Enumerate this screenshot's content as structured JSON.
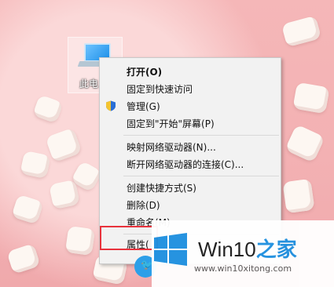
{
  "desktop": {
    "icon_label": "此电"
  },
  "context_menu": {
    "items": [
      {
        "label": "打开(O)",
        "bold": true
      },
      {
        "label": "固定到快速访问"
      },
      {
        "label": "管理(G)",
        "icon": "shield-icon"
      },
      {
        "label": "固定到\"开始\"屏幕(P)"
      },
      {
        "label": "映射网络驱动器(N)..."
      },
      {
        "label": "断开网络驱动器的连接(C)..."
      },
      {
        "label": "创建快捷方式(S)"
      },
      {
        "label": "删除(D)"
      },
      {
        "label": "重命名(M)"
      },
      {
        "label": "属性("
      }
    ]
  },
  "watermark": {
    "title": "Win10",
    "suffix": "之家",
    "url": "www.win10xitong.com"
  },
  "colors": {
    "highlight": "#e8323c",
    "brand_blue": "#1e90e0"
  }
}
